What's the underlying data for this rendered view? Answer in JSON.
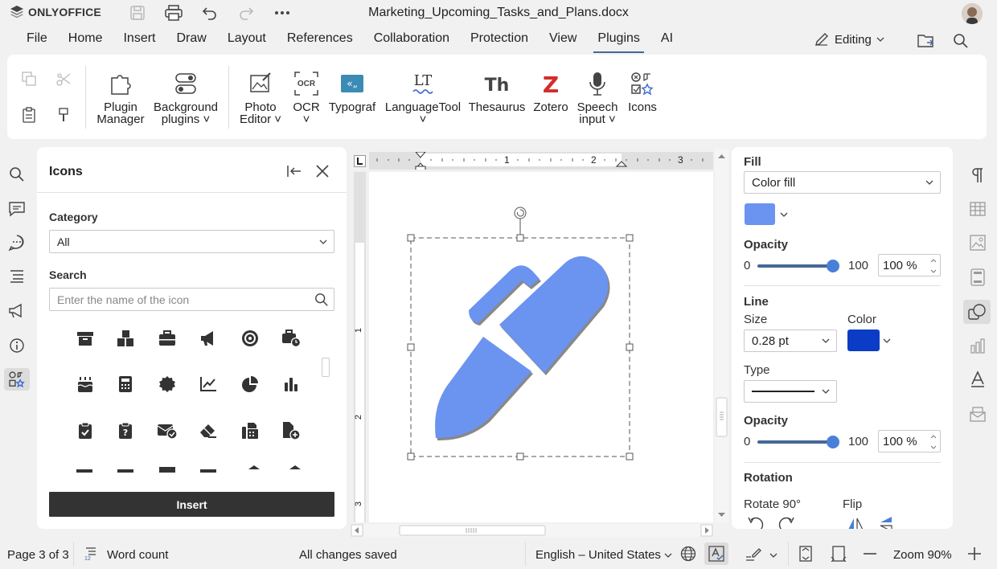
{
  "app": {
    "brand": "ONLYOFFICE",
    "doc_title": "Marketing_Upcoming_Tasks_and_Plans.docx"
  },
  "menu": [
    "File",
    "Home",
    "Insert",
    "Draw",
    "Layout",
    "References",
    "Collaboration",
    "Protection",
    "View",
    "Plugins",
    "AI"
  ],
  "active_menu": "Plugins",
  "editing_label": "Editing",
  "ribbon": {
    "plugin_manager": "Plugin Manager",
    "background_plugins": "Background plugins",
    "photo_editor": "Photo Editor",
    "ocr": "OCR",
    "typograf": "Typograf",
    "languagetool": "LanguageTool",
    "thesaurus": "Thesaurus",
    "zotero": "Zotero",
    "speech_input": "Speech input",
    "icons": "Icons",
    "plugin_manager_l1": "Plugin",
    "plugin_manager_l2": "Manager",
    "background_l1": "Background",
    "background_l2": "plugins",
    "photo_l1": "Photo",
    "photo_l2": "Editor",
    "speech_l1": "Speech",
    "speech_l2": "input",
    "ocr_icon_text": "OCR",
    "lt_icon_text": "LT",
    "th_icon_text": "Th",
    "z_icon_text": "Z"
  },
  "icons_panel": {
    "title": "Icons",
    "category_label": "Category",
    "category_value": "All",
    "search_label": "Search",
    "search_placeholder": "Enter the name of the icon",
    "insert_label": "Insert",
    "icons": [
      "archive-icon",
      "boxes-icon",
      "briefcase-icon",
      "bullhorn-icon",
      "bullseye-icon",
      "business-time-icon",
      "birthday-cake-icon",
      "calculator-icon",
      "certificate-icon",
      "chart-line-icon",
      "chart-pie-icon",
      "chart-bar-icon",
      "clipboard-check-icon",
      "clipboard-question-icon",
      "envelope-check-icon",
      "eraser-icon",
      "fax-icon",
      "file-circle-plus-icon"
    ]
  },
  "ruler": {
    "labels": [
      "1",
      "2",
      "3"
    ],
    "v_labels": [
      "1",
      "2",
      "3"
    ]
  },
  "shape": {
    "fill_color": "#6b93f0",
    "name": "pen-clip-icon"
  },
  "right_panel": {
    "fill_head": "Fill",
    "fill_type": "Color fill",
    "fill_color": "#6b93f0",
    "opacity_head": "Opacity",
    "opacity_min": "0",
    "opacity_max": "100",
    "opacity_value": "100 %",
    "opacity_fraction": 1.0,
    "line_head": "Line",
    "size_label": "Size",
    "size_value": "0.28 pt",
    "color_label": "Color",
    "line_color": "#0a3cc6",
    "type_label": "Type",
    "line_opacity_head": "Opacity",
    "line_opacity_min": "0",
    "line_opacity_max": "100",
    "line_opacity_value": "100 %",
    "rotation_head": "Rotation",
    "rotate_label": "Rotate 90°",
    "flip_label": "Flip"
  },
  "status": {
    "page": "Page 3 of 3",
    "word_count": "Word count",
    "saved": "All changes saved",
    "language": "English – United States",
    "zoom": "Zoom 90%"
  }
}
